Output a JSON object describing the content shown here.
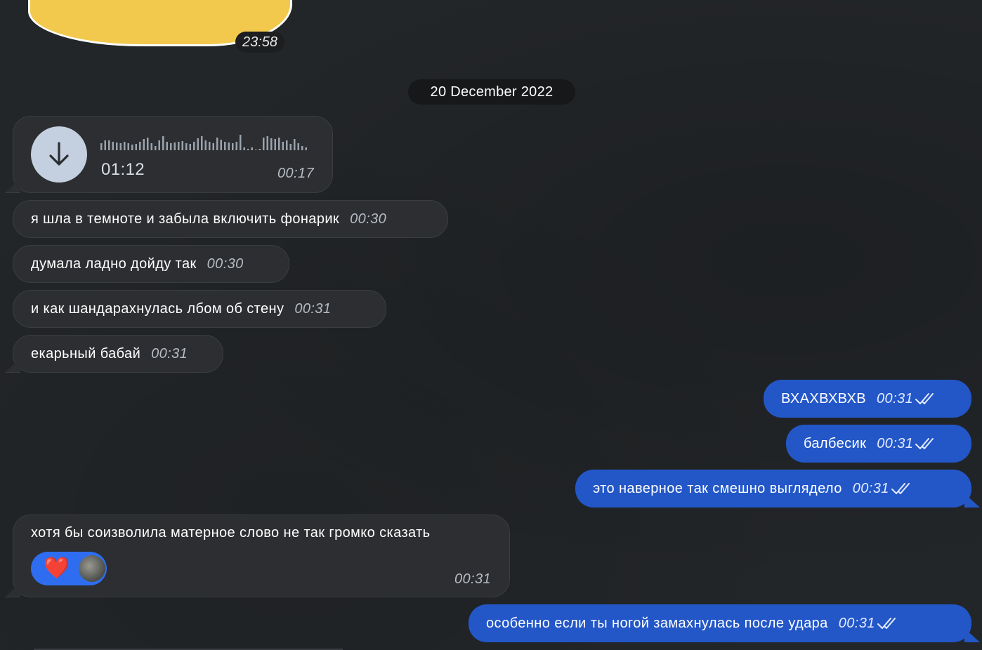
{
  "colors": {
    "background": "#232629",
    "incoming_bubble": "#2c2e31",
    "outgoing_bubble": "#2357c8",
    "reaction_bg": "#2f6df0",
    "sticker": "#f2c94c"
  },
  "sticker": {
    "time": "23:58"
  },
  "date_separator": "20 December 2022",
  "voice_message": {
    "icon": "download-arrow-icon",
    "duration": "01:12",
    "time": "00:17"
  },
  "messages": [
    {
      "direction": "in",
      "text": "я шла в темноте и забыла включить фонарик",
      "time": "00:30"
    },
    {
      "direction": "in",
      "text": "думала ладно дойду так",
      "time": "00:30"
    },
    {
      "direction": "in",
      "text": "и как шандарахнулась лбом об стену",
      "time": "00:31"
    },
    {
      "direction": "in",
      "text": "екарьный бабай",
      "time": "00:31"
    },
    {
      "direction": "out",
      "text": "ВХАХВХВХВ",
      "time": "00:31",
      "status": "double-check-icon"
    },
    {
      "direction": "out",
      "text": "балбесик",
      "time": "00:31",
      "status": "double-check-icon"
    },
    {
      "direction": "out",
      "text": "это наверное так смешно выглядело",
      "time": "00:31",
      "status": "double-check-icon"
    },
    {
      "direction": "in",
      "text": "хотя бы соизволила матерное слово не так громко сказать",
      "time": "00:31",
      "reaction": {
        "emoji": "❤️",
        "icon": "heart-icon"
      }
    },
    {
      "direction": "out",
      "text": "особенно если ты ногой замахнулась после удара",
      "time": "00:31",
      "status": "double-check-icon"
    }
  ]
}
